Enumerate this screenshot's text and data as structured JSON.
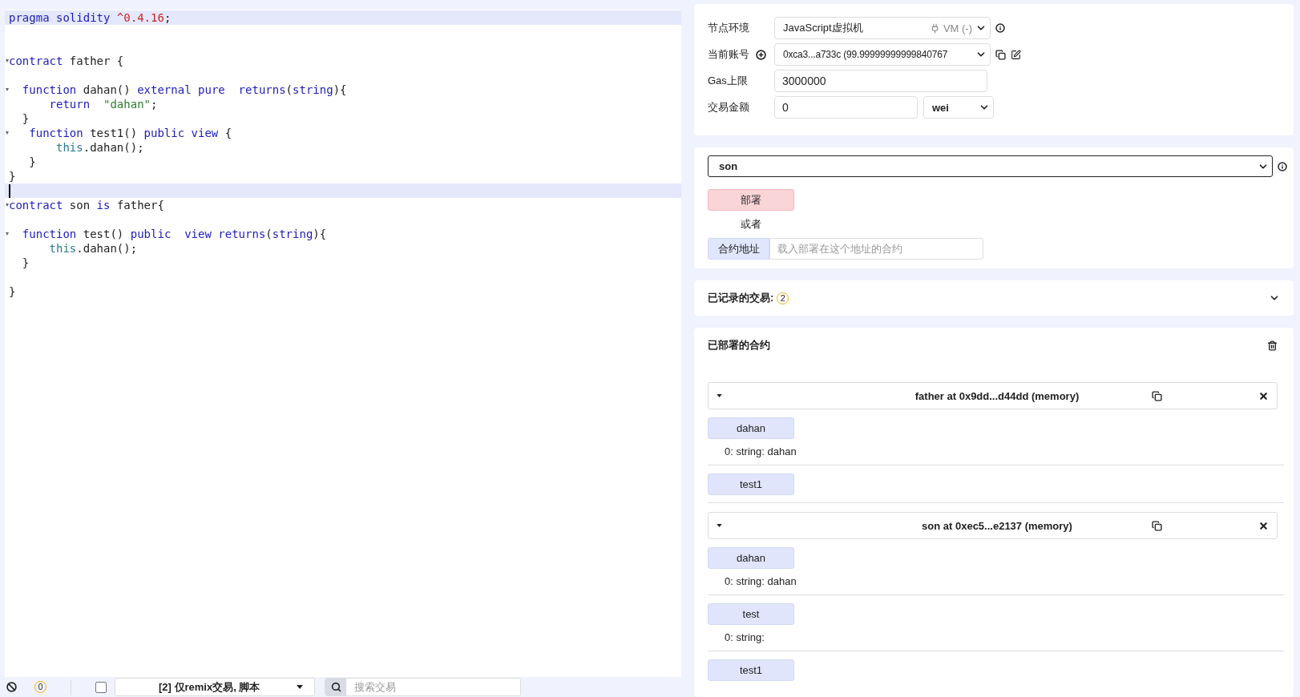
{
  "editor": {
    "lines": [
      {
        "fold": false,
        "highlighted": true,
        "cursor": false,
        "tokens": [
          {
            "kind": "kw",
            "text": "pragma"
          },
          {
            "kind": "kw",
            "text": " solidity"
          },
          {
            "kind": "num",
            "text": " ^0.4.16"
          },
          {
            "kind": "plain",
            "text": ";"
          }
        ]
      },
      {
        "fold": false,
        "highlighted": false,
        "cursor": false
      },
      {
        "fold": false,
        "highlighted": false,
        "cursor": false
      },
      {
        "fold": true,
        "highlighted": false,
        "cursor": false,
        "tokens": [
          {
            "kind": "kw",
            "text": "contract"
          },
          {
            "kind": "plain",
            "text": " father {"
          }
        ]
      },
      {
        "fold": false,
        "highlighted": false,
        "cursor": false
      },
      {
        "fold": true,
        "highlighted": false,
        "cursor": false,
        "tokens": [
          {
            "kind": "kw",
            "text": "  function"
          },
          {
            "kind": "plain",
            "text": " dahan() "
          },
          {
            "kind": "kw",
            "text": "external"
          },
          {
            "kind": "kw",
            "text": " pure"
          },
          {
            "kind": "kw",
            "text": "  returns"
          },
          {
            "kind": "plain",
            "text": "("
          },
          {
            "kind": "kw",
            "text": "string"
          },
          {
            "kind": "plain",
            "text": "){"
          }
        ]
      },
      {
        "fold": false,
        "highlighted": false,
        "cursor": false,
        "tokens": [
          {
            "kind": "kw",
            "text": "      return"
          },
          {
            "kind": "str",
            "text": "  \"dahan\""
          },
          {
            "kind": "plain",
            "text": ";"
          }
        ]
      },
      {
        "fold": false,
        "highlighted": false,
        "cursor": false,
        "tokens": [
          {
            "kind": "plain",
            "text": "  }"
          }
        ]
      },
      {
        "fold": true,
        "highlighted": false,
        "cursor": false,
        "tokens": [
          {
            "kind": "kw",
            "text": "   function"
          },
          {
            "kind": "plain",
            "text": " test1() "
          },
          {
            "kind": "kw",
            "text": "public"
          },
          {
            "kind": "kw",
            "text": " view"
          },
          {
            "kind": "plain",
            "text": " {"
          }
        ]
      },
      {
        "fold": false,
        "highlighted": false,
        "cursor": false,
        "tokens": [
          {
            "kind": "builtin",
            "text": "       this"
          },
          {
            "kind": "plain",
            "text": ".dahan();"
          }
        ]
      },
      {
        "fold": false,
        "highlighted": false,
        "cursor": false,
        "tokens": [
          {
            "kind": "plain",
            "text": "   }"
          }
        ]
      },
      {
        "fold": false,
        "highlighted": false,
        "cursor": false,
        "tokens": [
          {
            "kind": "plain",
            "text": "}"
          }
        ]
      },
      {
        "fold": false,
        "highlighted": true,
        "cursor": true
      },
      {
        "fold": true,
        "highlighted": false,
        "cursor": false,
        "tokens": [
          {
            "kind": "kw",
            "text": "contract"
          },
          {
            "kind": "plain",
            "text": " son "
          },
          {
            "kind": "kw",
            "text": "is"
          },
          {
            "kind": "plain",
            "text": " father{"
          }
        ]
      },
      {
        "fold": false,
        "highlighted": false,
        "cursor": false
      },
      {
        "fold": true,
        "highlighted": false,
        "cursor": false,
        "tokens": [
          {
            "kind": "kw",
            "text": "  function"
          },
          {
            "kind": "plain",
            "text": " test() "
          },
          {
            "kind": "kw",
            "text": "public"
          },
          {
            "kind": "kw",
            "text": "  view"
          },
          {
            "kind": "kw",
            "text": " returns"
          },
          {
            "kind": "plain",
            "text": "("
          },
          {
            "kind": "kw",
            "text": "string"
          },
          {
            "kind": "plain",
            "text": "){"
          }
        ]
      },
      {
        "fold": false,
        "highlighted": false,
        "cursor": false,
        "tokens": [
          {
            "kind": "builtin",
            "text": "      this"
          },
          {
            "kind": "plain",
            "text": ".dahan();"
          }
        ]
      },
      {
        "fold": false,
        "highlighted": false,
        "cursor": false,
        "tokens": [
          {
            "kind": "plain",
            "text": "  }"
          }
        ]
      },
      {
        "fold": false,
        "highlighted": false,
        "cursor": false
      },
      {
        "fold": false,
        "highlighted": false,
        "cursor": false,
        "tokens": [
          {
            "kind": "plain",
            "text": "}"
          }
        ]
      }
    ]
  },
  "terminal_bar": {
    "error_count": "0",
    "filter_checked": false,
    "filter": "[2] 仅remix交易, 脚本",
    "search_placeholder": "搜索交易"
  },
  "run_panel": {
    "environment": {
      "label": "节点环境",
      "value": "JavaScript虚拟机",
      "provider": "VM (-)"
    },
    "account": {
      "label": "当前账号",
      "value": "0xca3...a733c (99.99999999999840767"
    },
    "gas_limit": {
      "label": "Gas上限",
      "value": "3000000"
    },
    "value": {
      "label": "交易金额",
      "amount": "0",
      "unit": "wei"
    }
  },
  "contract_panel": {
    "selected_contract": "son",
    "deploy_button": "部署",
    "or_text": "或者",
    "at_address_button": "合约地址",
    "address_placeholder": "载入部署在这个地址的合约"
  },
  "recorded": {
    "title": "已记录的交易:",
    "count": "2"
  },
  "deployed": {
    "title": "已部署的合约",
    "instances": [
      {
        "title": "father at 0x9dd...d44dd (memory)",
        "expanded": true,
        "functions": [
          {
            "name": "dahan",
            "output": "0: string: dahan"
          },
          {
            "name": "test1"
          }
        ]
      },
      {
        "title": "son at 0xec5...e2137 (memory)",
        "expanded": true,
        "functions": [
          {
            "name": "dahan",
            "output": "0: string: dahan"
          },
          {
            "name": "test",
            "output": "0: string:"
          },
          {
            "name": "test1"
          }
        ]
      }
    ]
  }
}
